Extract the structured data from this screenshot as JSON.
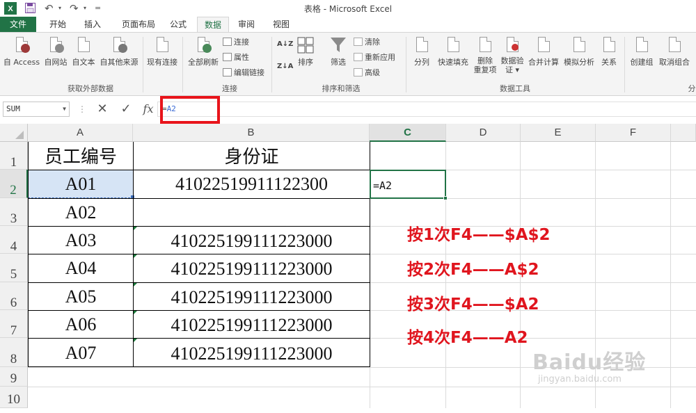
{
  "app": {
    "title": "表格 - Microsoft Excel",
    "quick_access": {
      "undo": "↶",
      "redo": "↷",
      "more": "="
    }
  },
  "tabs": [
    {
      "label": "文件"
    },
    {
      "label": "开始"
    },
    {
      "label": "插入"
    },
    {
      "label": "页面布局"
    },
    {
      "label": "公式"
    },
    {
      "label": "数据"
    },
    {
      "label": "审阅"
    },
    {
      "label": "视图"
    }
  ],
  "active_tab": "数据",
  "ribbon": {
    "groups": {
      "external": "获取外部数据",
      "connections": "连接",
      "sort_filter": "排序和筛选",
      "data_tools": "数据工具",
      "outline": "分"
    },
    "buttons": {
      "from_access": "自 Access",
      "from_web": "自网站",
      "from_text": "自文本",
      "from_other": "自其他来源",
      "existing_conn": "现有连接",
      "refresh_all": "全部刷新",
      "connections": "连接",
      "properties": "属性",
      "edit_links": "编辑链接",
      "sort_az": "A↓Z",
      "sort_za": "Z↓A",
      "sort": "排序",
      "filter": "筛选",
      "clear": "清除",
      "reapply": "重新应用",
      "advanced": "高级",
      "text_to_columns": "分列",
      "flash_fill": "快速填充",
      "remove_dup_1": "删除",
      "remove_dup_2": "重复项",
      "validation_1": "数据验",
      "validation_2": "证 ▾",
      "consolidate": "合并计算",
      "what_if": "模拟分析",
      "relationships": "关系",
      "group": "创建组",
      "ungroup": "取消组合"
    }
  },
  "formula_bar": {
    "name_box": "SUM",
    "cancel": "✕",
    "enter": "✓",
    "fx": "fx",
    "eq": "=",
    "ref": "A2"
  },
  "sheet": {
    "columns": [
      "A",
      "B",
      "C",
      "D",
      "E",
      "F"
    ],
    "selected_column": "C",
    "rows": [
      "1",
      "2",
      "3",
      "4",
      "5",
      "6",
      "7",
      "8",
      "9",
      "10"
    ],
    "selected_row": "2",
    "cells": {
      "A1": "员工编号",
      "B1": "身份证",
      "A2": "A01",
      "B2": "41022519911122300",
      "A3": "A02",
      "B3": "",
      "A4": "A03",
      "B4": "410225199111223000",
      "A5": "A04",
      "B5": "410225199111223000",
      "A6": "A05",
      "B6": "410225199111223000",
      "A7": "A06",
      "B7": "410225199111223000",
      "A8": "A07",
      "B8": "410225199111223000"
    },
    "editing_cell": {
      "ref": "C2",
      "content": "=A2"
    }
  },
  "notes": [
    "按1次F4——$A$2",
    "按2次F4——A$2",
    "按3次F4——$A2",
    "按4次F4——A2"
  ],
  "watermark": {
    "main": "Baidu经验",
    "sub": "jingyan.baidu.com"
  },
  "colors": {
    "excel_green": "#217346",
    "note_red": "#e0151e",
    "highlight_red": "#e8141b",
    "selection_blue": "#d6e4f5"
  }
}
